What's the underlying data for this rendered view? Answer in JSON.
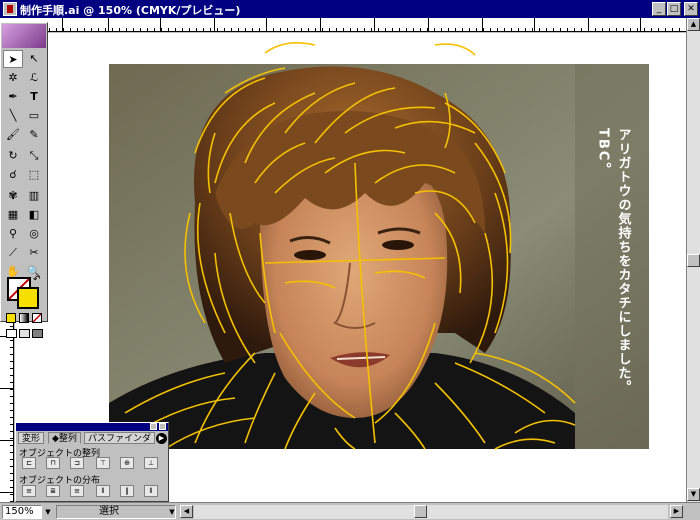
{
  "window": {
    "title": "制作手順.ai @ 150% (CMYK/プレビュー)",
    "minimize": "_",
    "maximize": "□",
    "close": "✕"
  },
  "document": {
    "vertical_text_1": "アリガトウの気持ちをカタチにしました。",
    "vertical_text_2": "TBC。"
  },
  "statusbar": {
    "zoom": "150%",
    "status": "選択"
  },
  "palette": {
    "tabs": [
      "変形",
      "整列",
      "パスファインダ"
    ],
    "section_align": "オブジェクトの整列",
    "section_distribute": "オブジェクトの分布"
  },
  "tools": [
    "selection-tool",
    "direct-selection-tool",
    "magic-wand-tool",
    "lasso-tool",
    "pen-tool",
    "type-tool",
    "line-tool",
    "rectangle-tool",
    "paintbrush-tool",
    "pencil-tool",
    "rotate-tool",
    "scale-tool",
    "warp-tool",
    "free-transform-tool",
    "symbol-sprayer-tool",
    "graph-tool",
    "mesh-tool",
    "gradient-tool",
    "eyedropper-tool",
    "blend-tool",
    "slice-tool",
    "scissors-tool",
    "hand-tool",
    "zoom-tool"
  ],
  "colors": {
    "fill": "#f7e000",
    "stroke": "#000000",
    "accent": "#000080",
    "trace": "#f5c000"
  }
}
